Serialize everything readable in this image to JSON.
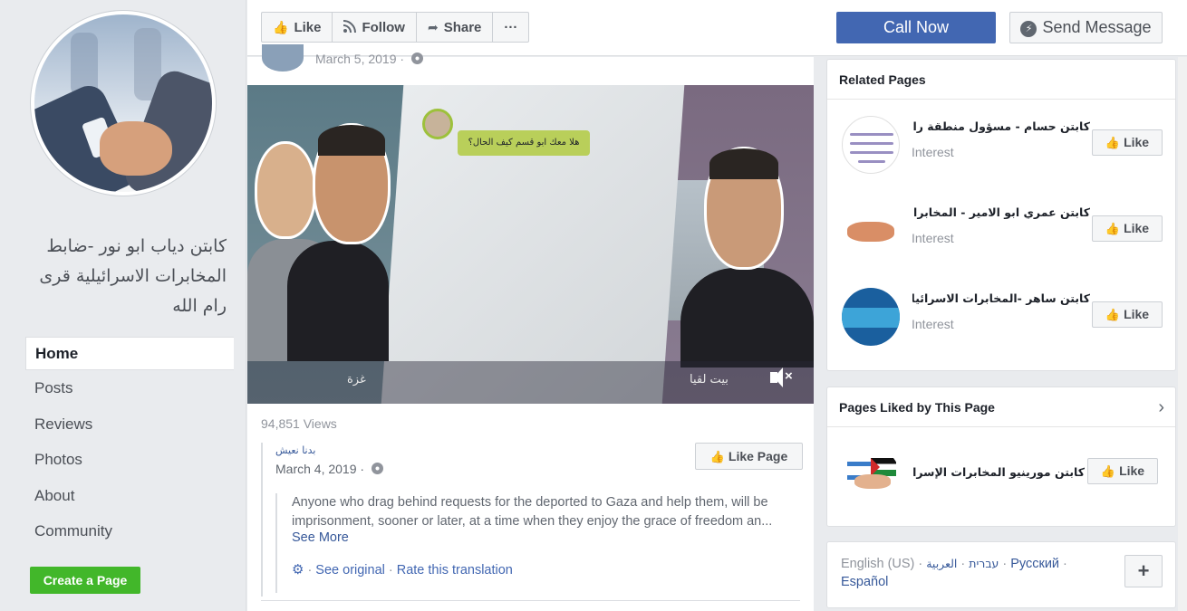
{
  "sidebar": {
    "page_name": "كابتن دياب ابو نور -ضابط المخابرات الاسرائيلية قرى رام الله",
    "nav": [
      {
        "label": "Home",
        "active": true
      },
      {
        "label": "Posts",
        "active": false
      },
      {
        "label": "Reviews",
        "active": false
      },
      {
        "label": "Photos",
        "active": false
      },
      {
        "label": "About",
        "active": false
      },
      {
        "label": "Community",
        "active": false
      }
    ],
    "create_page_label": "Create a Page"
  },
  "toolbar": {
    "like_label": "Like",
    "follow_label": "Follow",
    "share_label": "Share",
    "more_label": "···",
    "call_label": "Call Now",
    "message_label": "Send Message"
  },
  "post": {
    "date": "March 5, 2019",
    "video": {
      "chat_text": "هلا معك ابو قسم كيف الحال؟",
      "label_left": "غزة",
      "label_right": "بيت لقيا"
    },
    "views": "94,851 Views",
    "shared": {
      "author": "بدنا نعيش",
      "date": "March 4, 2019",
      "like_page_label": "Like Page",
      "text": "Anyone who drag behind requests for the deported to Gaza and help them, will be imprisonment, sooner or later, at a time when they enjoy the grace of freedom an...",
      "see_more": "See More",
      "see_original": "See original",
      "rate_translation": "Rate this translation"
    }
  },
  "related_pages": {
    "title": "Related Pages",
    "items": [
      {
        "name": "كابتن حسام - مسؤول منطقة رام ...",
        "category": "Interest",
        "like_label": "Like"
      },
      {
        "name": "كابتن عمري ابو الامير - المخابرا...",
        "category": "Interest",
        "like_label": "Like"
      },
      {
        "name": "كابتن ساهر -المخابرات الاسرائيلي...",
        "category": "Interest",
        "like_label": "Like"
      }
    ]
  },
  "pages_liked": {
    "title": "Pages Liked by This Page",
    "items": [
      {
        "name": "كابتن مورينيو المخابرات الإسرائ...",
        "like_label": "Like"
      }
    ]
  },
  "languages": {
    "current": "English (US)",
    "others": [
      "עברית",
      "العربية",
      "Русский",
      "Español"
    ],
    "plus_label": "+"
  },
  "colors": {
    "call_button": "#4267b2",
    "create_button": "#42b72a",
    "link": "#365899",
    "background": "#e9ebee"
  }
}
